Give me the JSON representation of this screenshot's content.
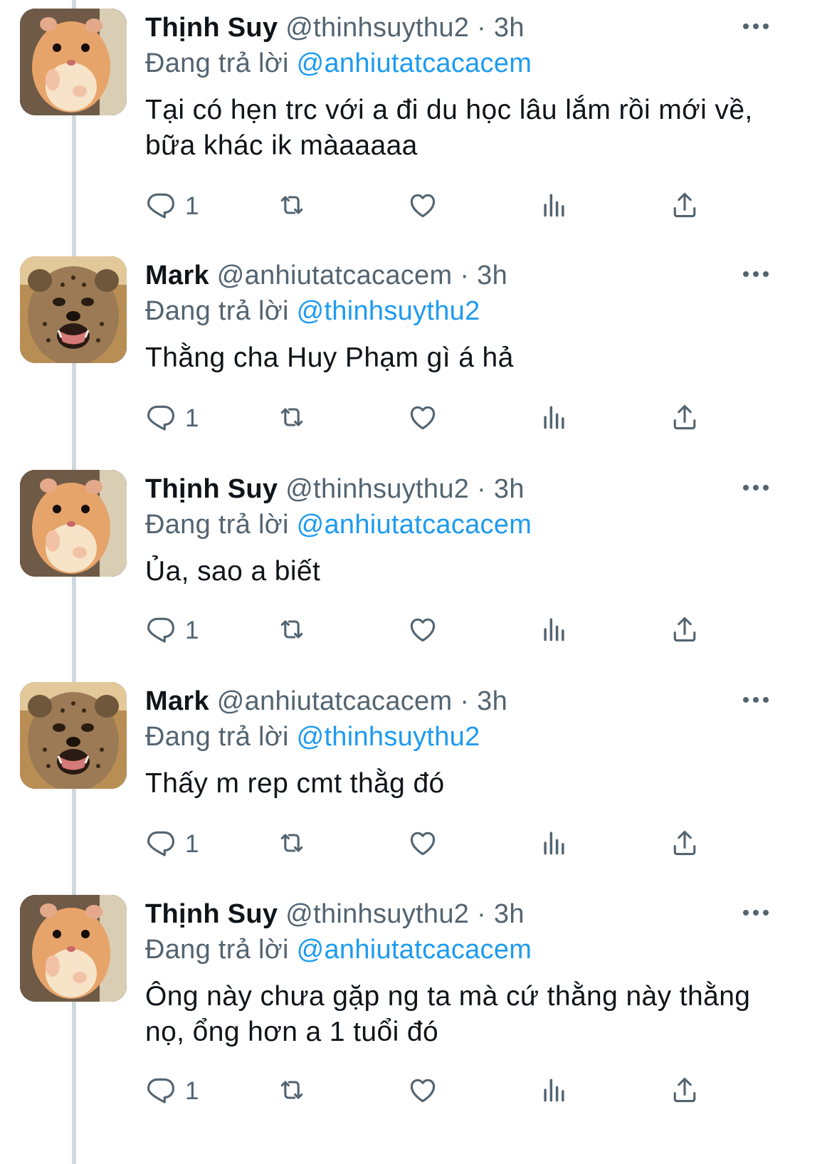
{
  "colors": {
    "link": "#1d9bf0",
    "muted": "#536471",
    "text": "#0f1419",
    "thread_line": "#cfd9de"
  },
  "tweets": [
    {
      "avatar_icon": "hamster-avatar",
      "name": "Thịnh Suy",
      "handle": "@thinhsuythu2",
      "separator": "·",
      "time": "3h",
      "reply_prefix": "Đang trả lời",
      "reply_to": "@anhiutatcacacem",
      "text": "Tại có hẹn trc với a đi du học lâu lắm rồi mới về, bữa khác ik màaaaaa",
      "reply_count": "1"
    },
    {
      "avatar_icon": "cheetah-avatar",
      "name": "Mark",
      "handle": "@anhiutatcacacem",
      "separator": "·",
      "time": "3h",
      "reply_prefix": "Đang trả lời",
      "reply_to": "@thinhsuythu2",
      "text": "Thằng cha Huy Phạm gì á hả",
      "reply_count": "1"
    },
    {
      "avatar_icon": "hamster-avatar",
      "name": "Thịnh Suy",
      "handle": "@thinhsuythu2",
      "separator": "·",
      "time": "3h",
      "reply_prefix": "Đang trả lời",
      "reply_to": "@anhiutatcacacem",
      "text": "Ủa, sao a biết",
      "reply_count": "1"
    },
    {
      "avatar_icon": "cheetah-avatar",
      "name": "Mark",
      "handle": "@anhiutatcacacem",
      "separator": "·",
      "time": "3h",
      "reply_prefix": "Đang trả lời",
      "reply_to": "@thinhsuythu2",
      "text": "Thấy m rep cmt thằg đó",
      "reply_count": "1"
    },
    {
      "avatar_icon": "hamster-avatar",
      "name": "Thịnh Suy",
      "handle": "@thinhsuythu2",
      "separator": "·",
      "time": "3h",
      "reply_prefix": "Đang trả lời",
      "reply_to": "@anhiutatcacacem",
      "text": "Ông này chưa gặp ng ta mà cứ thằng này thằng nọ, ổng hơn a 1 tuổi đó",
      "reply_count": "1"
    }
  ]
}
